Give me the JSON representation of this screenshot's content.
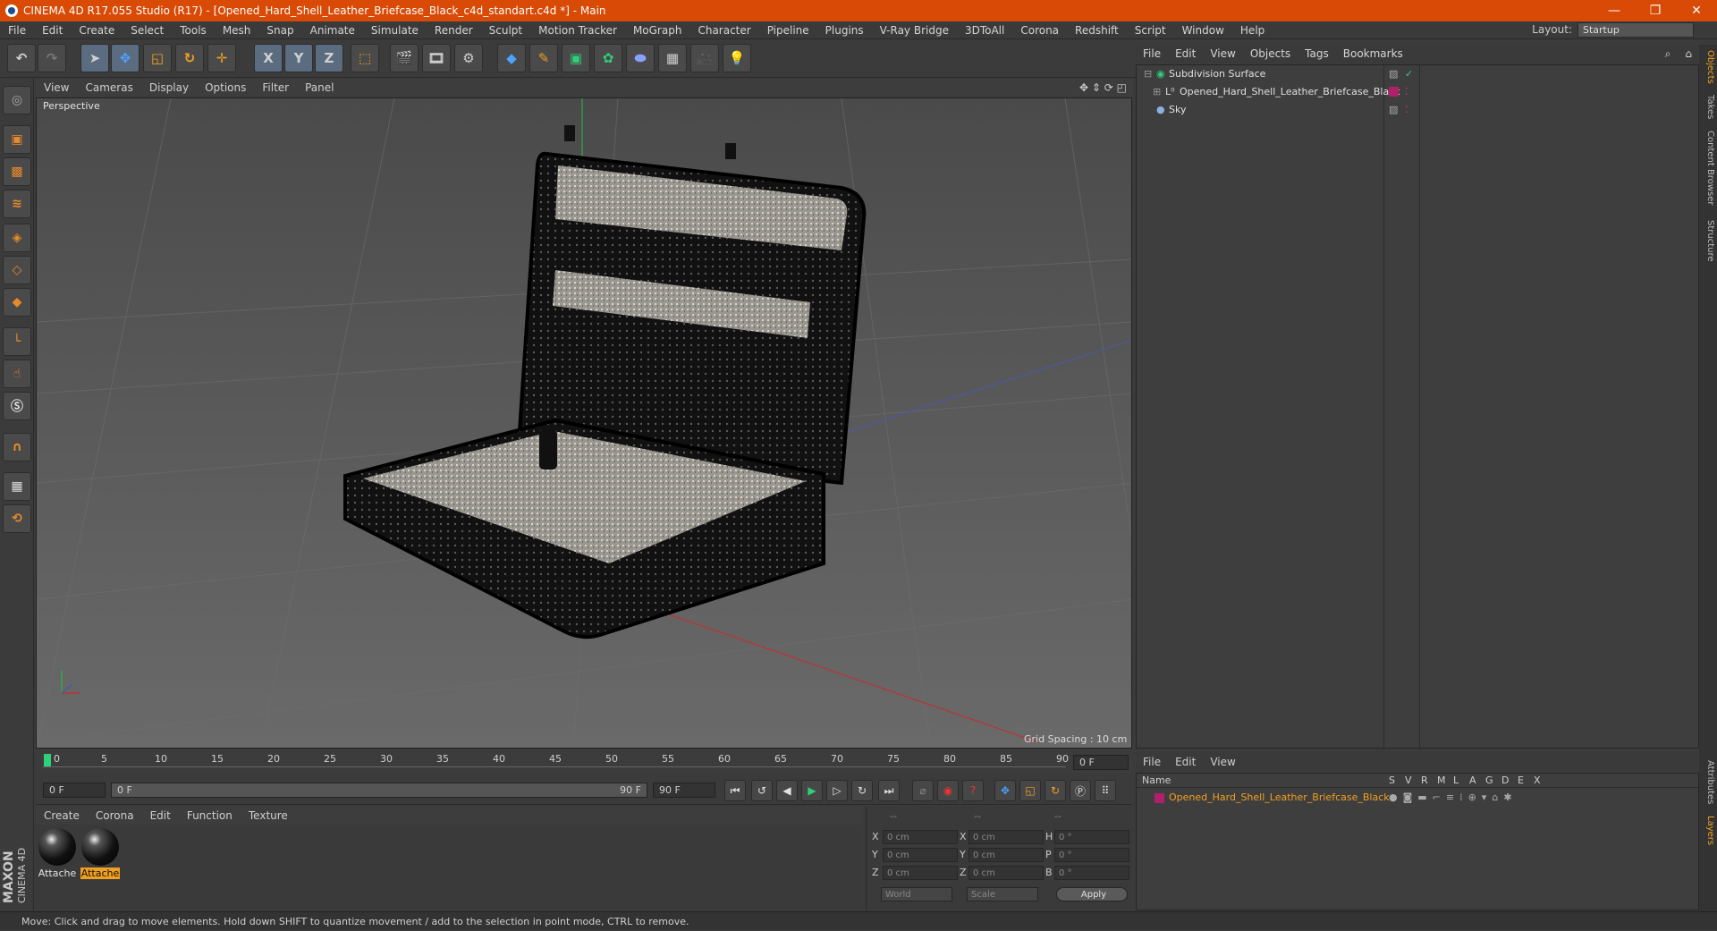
{
  "window": {
    "title": "CINEMA 4D R17.055 Studio (R17) - [Opened_Hard_Shell_Leather_Briefcase_Black_c4d_standart.c4d *] - Main",
    "minimize": "—",
    "restore": "❐",
    "close": "✕"
  },
  "menu": [
    "File",
    "Edit",
    "Create",
    "Select",
    "Tools",
    "Mesh",
    "Snap",
    "Animate",
    "Simulate",
    "Render",
    "Sculpt",
    "Motion Tracker",
    "MoGraph",
    "Character",
    "Pipeline",
    "Plugins",
    "V-Ray Bridge",
    "3DToAll",
    "Corona",
    "Redshift",
    "Script",
    "Window",
    "Help"
  ],
  "layout": {
    "label": "Layout:",
    "value": "Startup"
  },
  "toolbar": {
    "axis_x": "X",
    "axis_y": "Y",
    "axis_z": "Z"
  },
  "viewport": {
    "menu": [
      "View",
      "Cameras",
      "Display",
      "Options",
      "Filter",
      "Panel"
    ],
    "camera_label": "Perspective",
    "grid_spacing": "Grid Spacing : 10 cm"
  },
  "timeline": {
    "ticks": [
      "0",
      "5",
      "10",
      "15",
      "20",
      "25",
      "30",
      "35",
      "40",
      "45",
      "50",
      "55",
      "60",
      "65",
      "70",
      "75",
      "80",
      "85",
      "90"
    ],
    "current_frame": "0 F",
    "start_field": "0 F",
    "range_start": "0 F",
    "range_end": "90 F",
    "end_field": "90 F"
  },
  "materials": {
    "menu": [
      "Create",
      "Corona",
      "Edit",
      "Function",
      "Texture"
    ],
    "items": [
      {
        "label": "Attache",
        "selected": false
      },
      {
        "label": "Attache",
        "selected": true
      }
    ]
  },
  "coords": {
    "headers": [
      "--",
      "--",
      "--"
    ],
    "rows": [
      {
        "a": "X",
        "av": "0 cm",
        "b": "X",
        "bv": "0 cm",
        "c": "H",
        "cv": "0 °"
      },
      {
        "a": "Y",
        "av": "0 cm",
        "b": "Y",
        "bv": "0 cm",
        "c": "P",
        "cv": "0 °"
      },
      {
        "a": "Z",
        "av": "0 cm",
        "b": "Z",
        "bv": "0 cm",
        "c": "B",
        "cv": "0 °"
      }
    ],
    "mode1": "World",
    "mode2": "Scale",
    "apply": "Apply"
  },
  "objects": {
    "menu": [
      "File",
      "Edit",
      "View",
      "Objects",
      "Tags",
      "Bookmarks"
    ],
    "items": [
      {
        "name": "Subdivision Surface"
      },
      {
        "name": "Opened_Hard_Shell_Leather_Briefcase_Black"
      },
      {
        "name": "Sky"
      }
    ]
  },
  "layers": {
    "menu": [
      "File",
      "Edit",
      "View"
    ],
    "col_name": "Name",
    "cols": [
      "S",
      "V",
      "R",
      "M",
      "L",
      "A",
      "G",
      "D",
      "E",
      "X"
    ],
    "item": "Opened_Hard_Shell_Leather_Briefcase_Black"
  },
  "side_tabs": [
    "Objects",
    "Takes",
    "Content Browser",
    "Structure",
    "Attributes",
    "Layers"
  ],
  "maxon": {
    "brand": "MAXON",
    "product": "CINEMA 4D"
  },
  "status": "Move: Click and drag to move elements. Hold down SHIFT to quantize movement / add to the selection in point mode, CTRL to remove.",
  "colors": {
    "title_bar": "#d84a05",
    "accent": "#f0a020",
    "layer_color": "#b0206a"
  }
}
